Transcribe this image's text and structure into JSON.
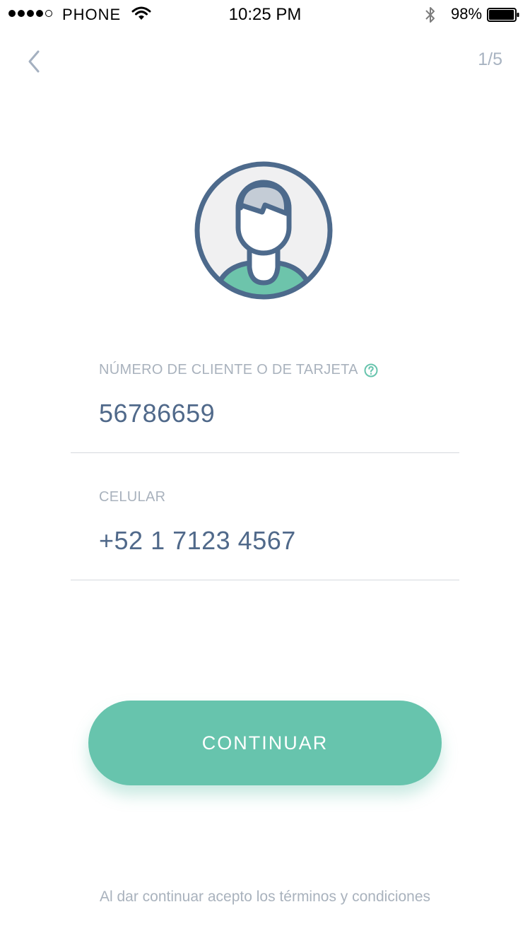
{
  "status_bar": {
    "carrier": "PHONE",
    "time": "10:25 PM",
    "battery_percent": "98%",
    "battery_level": 0.98,
    "signal_bars_filled": 4,
    "signal_bars_total": 5,
    "icons": [
      "wifi-icon",
      "bluetooth-icon",
      "battery-icon"
    ]
  },
  "nav": {
    "back_icon": "chevron-left-icon",
    "step": "1/5"
  },
  "avatar": {
    "icon": "user-avatar-icon"
  },
  "form": {
    "client": {
      "label": "NÚMERO DE CLIENTE O DE TARJETA",
      "help_icon": "question-circle-icon",
      "value": "56786659"
    },
    "phone": {
      "label": "CELULAR",
      "value": "+52 1 7123 4567"
    }
  },
  "actions": {
    "continue_label": "CONTINUAR"
  },
  "footer": {
    "terms": "Al dar continuar acepto los términos y condiciones"
  },
  "colors": {
    "accent": "#67c4ad",
    "primary_text": "#50698a",
    "secondary_text": "#a9b2bd",
    "divider": "#d6d9de"
  }
}
